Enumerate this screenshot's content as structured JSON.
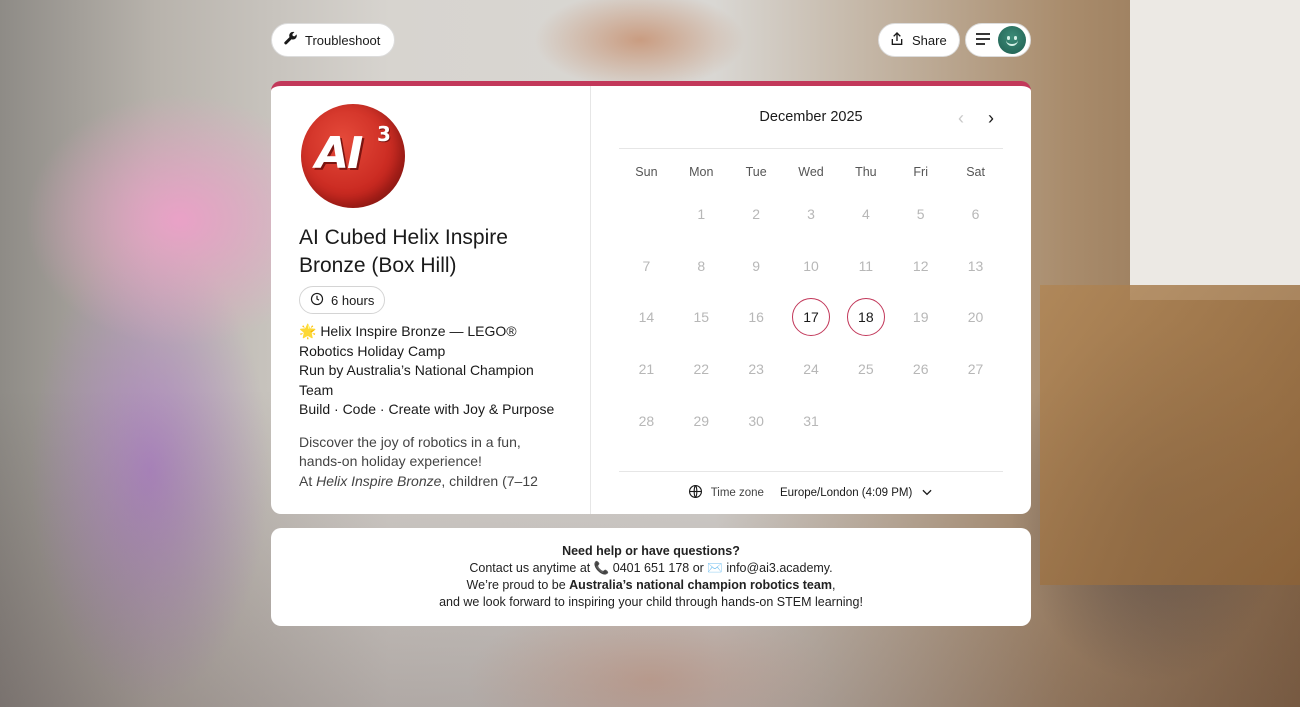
{
  "topbar": {
    "troubleshoot_label": "Troubleshoot",
    "share_label": "Share"
  },
  "event": {
    "logo_text": "AI",
    "logo_sup": "3",
    "title": "AI Cubed Helix Inspire Bronze (Box Hill)",
    "duration": "6 hours",
    "desc_lines": [
      "🌟 Helix Inspire Bronze — LEGO® Robotics Holiday Camp",
      "Run by Australia’s National Champion Team",
      "Build · Code · Create with Joy & Purpose"
    ],
    "intro_line1": "Discover the joy of robotics in a fun, hands-on holiday experience!",
    "intro_at": "At ",
    "intro_em": "Helix Inspire Bronze",
    "intro_rest": ", children (7–12"
  },
  "calendar": {
    "month_label": "December 2025",
    "prev_symbol": "‹",
    "next_symbol": "›",
    "weekdays": [
      "Sun",
      "Mon",
      "Tue",
      "Wed",
      "Thu",
      "Fri",
      "Sat"
    ],
    "days": [
      "",
      "1",
      "2",
      "3",
      "4",
      "5",
      "6",
      "7",
      "8",
      "9",
      "10",
      "11",
      "12",
      "13",
      "14",
      "15",
      "16",
      "17",
      "18",
      "19",
      "20",
      "21",
      "22",
      "23",
      "24",
      "25",
      "26",
      "27",
      "28",
      "29",
      "30",
      "31"
    ],
    "available_days": [
      "17",
      "18"
    ],
    "accent_color": "#c2385a"
  },
  "timezone": {
    "label": "Time zone",
    "value": "Europe/London (4:09 PM)"
  },
  "help": {
    "question": "Need help or have questions?",
    "contact_prefix": "Contact us anytime at 📞 0401 651 178 or ✉️ info@ai3.academy.",
    "proud_prefix": "We’re proud to be ",
    "proud_bold": "Australia’s national champion robotics team",
    "proud_suffix": ",",
    "closing": "and we look forward to inspiring your child through hands-on STEM learning!"
  }
}
